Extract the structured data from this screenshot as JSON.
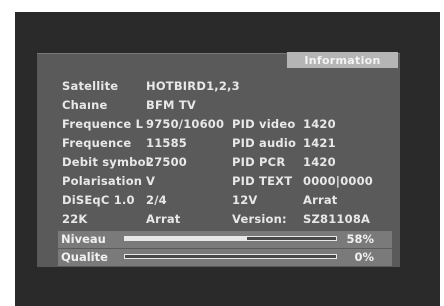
{
  "header": {
    "title": "Information"
  },
  "rows": [
    {
      "label": "Satellite",
      "value": "HOTBIRD1,2,3",
      "label2": "",
      "value2": ""
    },
    {
      "label": "Chaıne",
      "value": "BFM TV",
      "label2": "",
      "value2": ""
    },
    {
      "label": "Frequence L",
      "value": "9750/10600",
      "label2": "PID video",
      "value2": "1420"
    },
    {
      "label": "Frequence",
      "value": "11585",
      "label2": "PID audio",
      "value2": "1421"
    },
    {
      "label": "Debit symbol",
      "value": "27500",
      "label2": "PID PCR",
      "value2": "1420"
    },
    {
      "label": "Polarisation",
      "value": "V",
      "label2": "PID TEXT",
      "value2": "0000|0000"
    },
    {
      "label": "DiSEqC 1.0",
      "value": "2/4",
      "label2": "12V",
      "value2": "Arrat"
    },
    {
      "label": "22K",
      "value": "Arrat",
      "label2": "Version:",
      "value2": "SZ81108A"
    }
  ],
  "meters": [
    {
      "label": "Niveau",
      "value_text": "58%",
      "fraction": 0.58
    },
    {
      "label": "Qualite",
      "value_text": "0%",
      "fraction": 0.0
    }
  ]
}
